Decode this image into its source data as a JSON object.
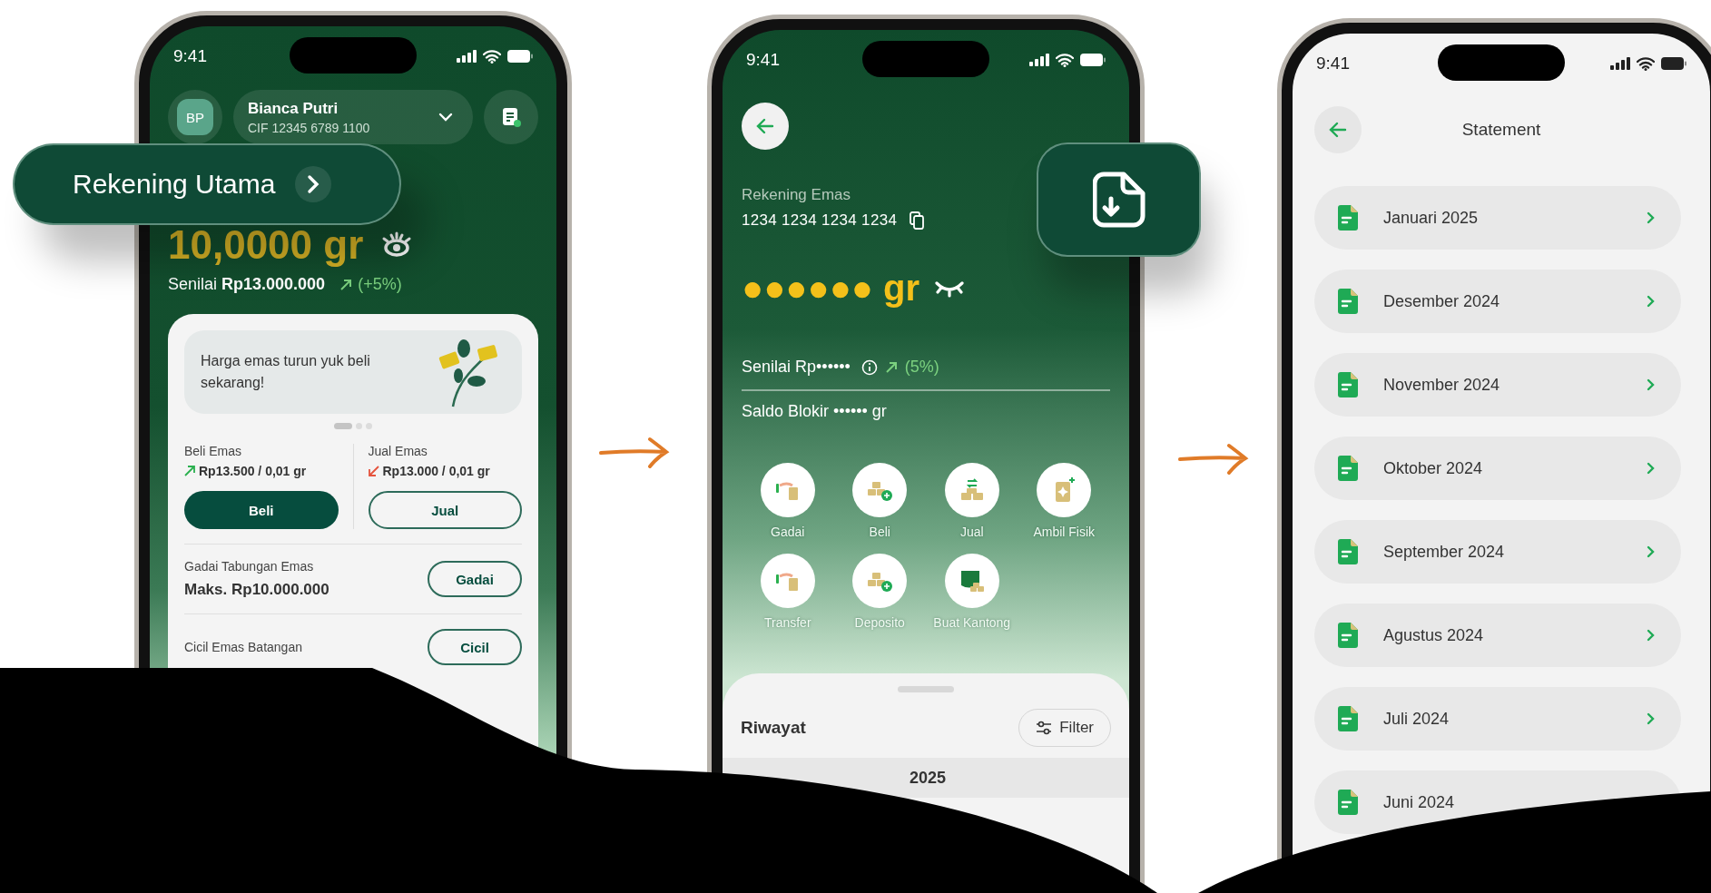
{
  "callouts": {
    "account_button": "Rekening Utama"
  },
  "home_screen": {
    "time": "9:41",
    "avatar_initials": "BP",
    "account": {
      "name": "Bianca Putri",
      "cif": "CIF 12345 6789 1100"
    },
    "balance": "10,0000 gr",
    "value": "Senilai **Rp13.000.000**",
    "change": "(+5%)",
    "promo": "Harga emas turun yuk beli sekarang!",
    "pager": [
      {
        "selected": true
      },
      {
        "selected": false
      },
      {
        "selected": false
      }
    ],
    "prices": [
      {
        "label": "Beli Emas",
        "price": "Rp13.500 / 0,01 gr",
        "kind": "up",
        "button": {
          "label": "Beli",
          "kind": "primary"
        }
      },
      {
        "label": "Jual Emas",
        "price": "Rp13.000 / 0,01 gr",
        "kind": "down",
        "button": {
          "label": "Jual",
          "kind": "outline"
        }
      }
    ],
    "products": [
      {
        "title": "Gadai Tabungan Emas",
        "detail": "Maks. Rp10.000.000",
        "button": "Gadai"
      },
      {
        "title": "Cicil Emas Batangan",
        "button": "Cicil"
      }
    ]
  },
  "account_screen": {
    "time": "9:41",
    "account_label": "Rekening Emas",
    "account_number": "1234 1234 1234 1234",
    "balance": "●●●●●● gr",
    "value": "Senilai Rp••••••",
    "change": "(5%)",
    "blocked": "Saldo Blokir •••••• gr",
    "actions": [
      {
        "label": "Gadai",
        "kind": "pawn"
      },
      {
        "label": "Beli",
        "kind": "buy"
      },
      {
        "label": "Jual",
        "kind": "sell"
      },
      {
        "label": "Ambil Fisik",
        "kind": "pickup"
      },
      {
        "label": "Transfer",
        "kind": "pawn"
      },
      {
        "label": "Deposito",
        "kind": "buy"
      },
      {
        "label": "Buat Kantong",
        "kind": "pocket"
      }
    ],
    "history": {
      "title": "Riwayat",
      "filter": "Filter",
      "group": "2025"
    }
  },
  "statement_screen": {
    "time": "9:41",
    "title": "Statement",
    "items": [
      "Januari 2025",
      "Desember 2024",
      "November 2024",
      "Oktober 2024",
      "September 2024",
      "Agustus 2024",
      "Juli 2024",
      "Juni 2024"
    ]
  }
}
